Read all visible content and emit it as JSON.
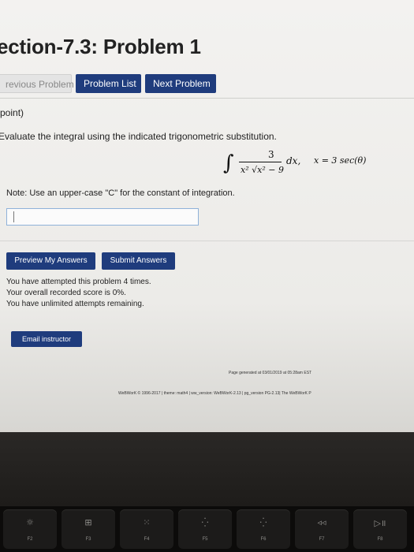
{
  "page": {
    "title": "ection-7.3: Problem 1",
    "nav": {
      "previous": "revious Problem",
      "list": "Problem List",
      "next": "Next Problem"
    },
    "points": "point)",
    "instruction": "Evaluate the integral using the indicated trigonometric substitution.",
    "formula": {
      "integral_sign": "∫",
      "numerator": "3",
      "denominator": "x² √x² − 9",
      "differential": "dx,",
      "substitution": "x = 3 sec(θ)"
    },
    "note": "Note: Use an upper-case \"C\" for the constant of integration.",
    "answer": {
      "value": "",
      "placeholder": ""
    },
    "buttons": {
      "preview": "Preview My Answers",
      "submit": "Submit Answers",
      "email": "Email instructor"
    },
    "status": {
      "attempts": "You have attempted this problem 4 times.",
      "score": "Your overall recorded score is 0%.",
      "remaining": "You have unlimited attempts remaining."
    },
    "footer": {
      "generated": "Page generated at 03/01/2019 at 05:28am EST",
      "credits": "WeBWorK © 1996-2017 | theme: math4 | ww_version: WeBWorK-2.13 | pg_version PG-2.13| The WeBWorK P"
    }
  },
  "colors": {
    "primary_button": "#1f3c7d",
    "input_border": "#8fb2d9",
    "page_bg": "#f3f2f0"
  },
  "keyboard": {
    "keys": [
      {
        "icon": "brightness-up-icon",
        "glyph": "☼",
        "label": "F2"
      },
      {
        "icon": "mission-control-icon",
        "glyph": "⊞",
        "label": "F3"
      },
      {
        "icon": "launchpad-icon",
        "glyph": "⁙",
        "label": "F4"
      },
      {
        "icon": "keyboard-light-down-icon",
        "glyph": "⁛",
        "label": "F5"
      },
      {
        "icon": "keyboard-light-up-icon",
        "glyph": "⁛",
        "label": "F6"
      },
      {
        "icon": "rewind-icon",
        "glyph": "◃◃",
        "label": "F7"
      },
      {
        "icon": "play-pause-icon",
        "glyph": "▷॥",
        "label": "F8"
      }
    ]
  }
}
